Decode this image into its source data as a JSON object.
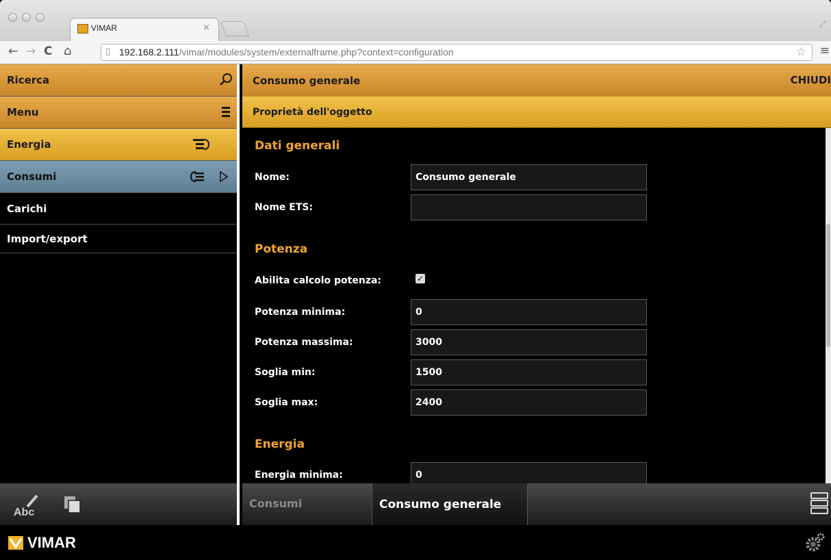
{
  "browser": {
    "tab_title": "VIMAR",
    "tab_close": "×",
    "url_host": "192.168.2.111",
    "url_path": "/vimar/modules/system/externalframe.php?context=configuration"
  },
  "sidebar": {
    "search_label": "Ricerca",
    "menu_label": "Menu",
    "items": [
      {
        "label": "Energia"
      },
      {
        "label": "Consumi"
      },
      {
        "label": "Carichi"
      },
      {
        "label": "Import/export"
      }
    ],
    "footer_abc": "Abc"
  },
  "main": {
    "title": "Consumo generale",
    "close_label": "CHIUDI",
    "section_bar": "Proprietà dell'oggetto",
    "groups": [
      {
        "heading": "Dati generali",
        "fields": [
          {
            "label": "Nome:",
            "value": "Consumo generale"
          },
          {
            "label": "Nome ETS:",
            "value": ""
          }
        ]
      },
      {
        "heading": "Potenza",
        "fields": [
          {
            "label": "Abilita calcolo potenza:",
            "checked": true
          },
          {
            "label": "Potenza minima:",
            "value": "0"
          },
          {
            "label": "Potenza massima:",
            "value": "3000"
          },
          {
            "label": "Soglia min:",
            "value": "1500"
          },
          {
            "label": "Soglia max:",
            "value": "2400"
          }
        ]
      },
      {
        "heading": "Energia",
        "fields": [
          {
            "label": "Energia minima:",
            "value": "0"
          }
        ]
      }
    ],
    "breadcrumb": [
      "Consumi",
      "Consumo generale"
    ]
  },
  "footer": {
    "brand": "VIMAR"
  },
  "colors": {
    "accent_orange": "#e8aa4a",
    "accent_yellow": "#f1c24a",
    "heading": "#f0a532",
    "selected_item": "#6d8ea3"
  },
  "icons": [
    "search-icon",
    "menu-icon",
    "list-icon",
    "back-list-icon",
    "play-icon",
    "pencil-icon",
    "copy-icon",
    "stack-icon",
    "gear-icon",
    "vimar-logo-icon"
  ]
}
